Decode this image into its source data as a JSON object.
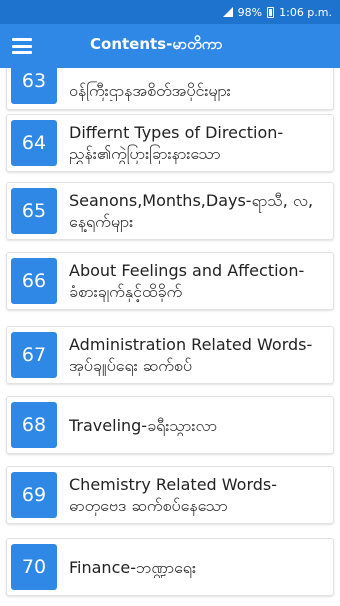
{
  "status_bar": {
    "battery": "98%",
    "time": "1:06 p.m."
  },
  "app_bar": {
    "title": "Contents-မာတိကာ",
    "menu_icon": "hamburger-menu-icon"
  },
  "colors": {
    "primary": "#2f87e6",
    "status_bar": "#1e73cf"
  },
  "items": [
    {
      "number": "63",
      "label": "ဝန်ကြီးဌာနအစိတ်အပိုင်းများ"
    },
    {
      "number": "64",
      "label": "Differnt Types of Direction-ညွှန်း၏ကွဲပြားခြားနားသော"
    },
    {
      "number": "65",
      "label": "Seanons,Months,Days-ရာသီ, လ, နေ့ရက်များ"
    },
    {
      "number": "66",
      "label": "About Feelings and Affection-ခံစားချက်နှင့်ထိခိုက်"
    },
    {
      "number": "67",
      "label": "Administration Related Words-အုပ်ချုပ်ရေး ဆက်စပ်"
    },
    {
      "number": "68",
      "label": "Traveling-ခရီးသွားလာ"
    },
    {
      "number": "69",
      "label": "Chemistry Related Words-ဓာတုဗေဒ ဆက်စပ်နေသော"
    },
    {
      "number": "70",
      "label": "Finance-ဘဏ္ဍာရေး"
    }
  ]
}
